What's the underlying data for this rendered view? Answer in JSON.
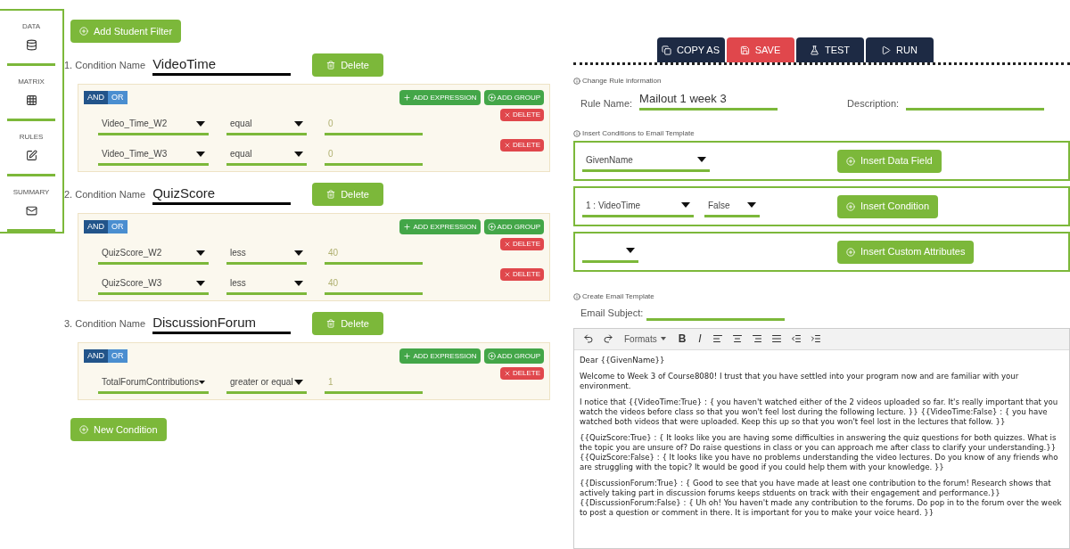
{
  "sidebar": {
    "items": [
      {
        "label": "DATA",
        "kind": "database"
      },
      {
        "label": "MATRIX",
        "kind": "grid"
      },
      {
        "label": "RULES",
        "kind": "edit"
      },
      {
        "label": "SUMMARY",
        "kind": "mail"
      }
    ]
  },
  "filters": {
    "add_button": "Add Student Filter",
    "new_button": "New Condition",
    "conditions": [
      {
        "number": "1.",
        "label": "Condition Name",
        "name": "VideoTime",
        "delete": "Delete",
        "group": {
          "logic": [
            {
              "label": "AND",
              "selected": true
            },
            {
              "label": "OR",
              "selected": false
            }
          ],
          "add_expression": "ADD EXPRESSION",
          "add_group": "ADD GROUP",
          "rules": [
            {
              "field": "Video_Time_W2",
              "operator": "equal",
              "value": "0",
              "delete": "DELETE"
            },
            {
              "field": "Video_Time_W3",
              "operator": "equal",
              "value": "0",
              "delete": "DELETE"
            }
          ]
        }
      },
      {
        "number": "2.",
        "label": "Condition Name",
        "name": "QuizScore",
        "delete": "Delete",
        "group": {
          "logic": [
            {
              "label": "AND",
              "selected": true
            },
            {
              "label": "OR",
              "selected": false
            }
          ],
          "add_expression": "ADD EXPRESSION",
          "add_group": "ADD GROUP",
          "rules": [
            {
              "field": "QuizScore_W2",
              "operator": "less",
              "value": "40",
              "delete": "DELETE"
            },
            {
              "field": "QuizScore_W3",
              "operator": "less",
              "value": "40",
              "delete": "DELETE"
            }
          ]
        }
      },
      {
        "number": "3.",
        "label": "Condition Name",
        "name": "DiscussionForum",
        "delete": "Delete",
        "group": {
          "logic": [
            {
              "label": "AND",
              "selected": true
            },
            {
              "label": "OR",
              "selected": false
            }
          ],
          "add_expression": "ADD EXPRESSION",
          "add_group": "ADD GROUP",
          "rules": [
            {
              "field": "TotalForumContributions",
              "operator": "greater or equal",
              "value": "1",
              "delete": "DELETE"
            }
          ]
        }
      }
    ]
  },
  "toolbar": [
    {
      "label": "COPY AS",
      "kind": "copy"
    },
    {
      "label": "SAVE",
      "kind": "save"
    },
    {
      "label": "TEST",
      "kind": "test"
    },
    {
      "label": "RUN",
      "kind": "run"
    }
  ],
  "rule_info": {
    "heading": "Change Rule information",
    "name_label": "Rule Name:",
    "name_value": "Mailout 1 week 3",
    "description_label": "Description:"
  },
  "insert": {
    "heading": "Insert Conditions to Email Template",
    "rows": [
      {
        "kind": "data",
        "selects": [
          "GivenName"
        ],
        "button": "Insert Data Field"
      },
      {
        "kind": "condition",
        "selects": [
          "1 : VideoTime",
          "False"
        ],
        "button": "Insert Condition"
      },
      {
        "kind": "custom",
        "button": "Insert Custom Attributes"
      }
    ]
  },
  "email": {
    "heading": "Create Email Template",
    "subject_label": "Email Subject:",
    "editor_tools": [
      {
        "kind": "undo"
      },
      {
        "kind": "redo"
      },
      {
        "kind": "formats",
        "label": "Formats"
      },
      {
        "kind": "bold",
        "label": "B"
      },
      {
        "kind": "italic",
        "label": "I"
      },
      {
        "kind": "align-left"
      },
      {
        "kind": "align-center"
      },
      {
        "kind": "align-right"
      },
      {
        "kind": "justify"
      },
      {
        "kind": "outdent"
      },
      {
        "kind": "indent"
      }
    ],
    "paragraphs": [
      "Dear {{GivenName}}",
      "Welcome to Week 3 of Course8080! I trust that you have settled into your program now and are familiar with your environment.",
      "I notice that {{VideoTime:True} : { you haven't watched either of the 2 videos uploaded so far. It's really important that you watch the videos before class so that you won't feel lost during the following lecture. }} {{VideoTime:False} : { you have watched both videos that were uploaded. Keep this up so that you won't feel lost in the lectures that follow. }}",
      "{{QuizScore:True} : { It looks like you are having some difficulties in answering the quiz questions for both quizzes. What is the topic you are unsure of? Do raise questions in class or you can approach me after class to clarify your understanding.}} {{QuizScore:False} : { It looks like you have no problems understanding the video lectures. Do you know of any friends who are struggling with the topic? It would be good if you could help them with your knowledge. }}",
      "{{DiscussionForum:True} : { Good to see that you have made at least one contribution to the forum! Research shows that actively taking part in discussion forums keeps stduents on track with their engagement and performance.}} {{DiscussionForum:False} : { Uh oh! You haven't made any contribution to the forums. Do pop in to the forum over the week to post a question or comment in there. It is important for you to make your voice heard. }}"
    ]
  }
}
